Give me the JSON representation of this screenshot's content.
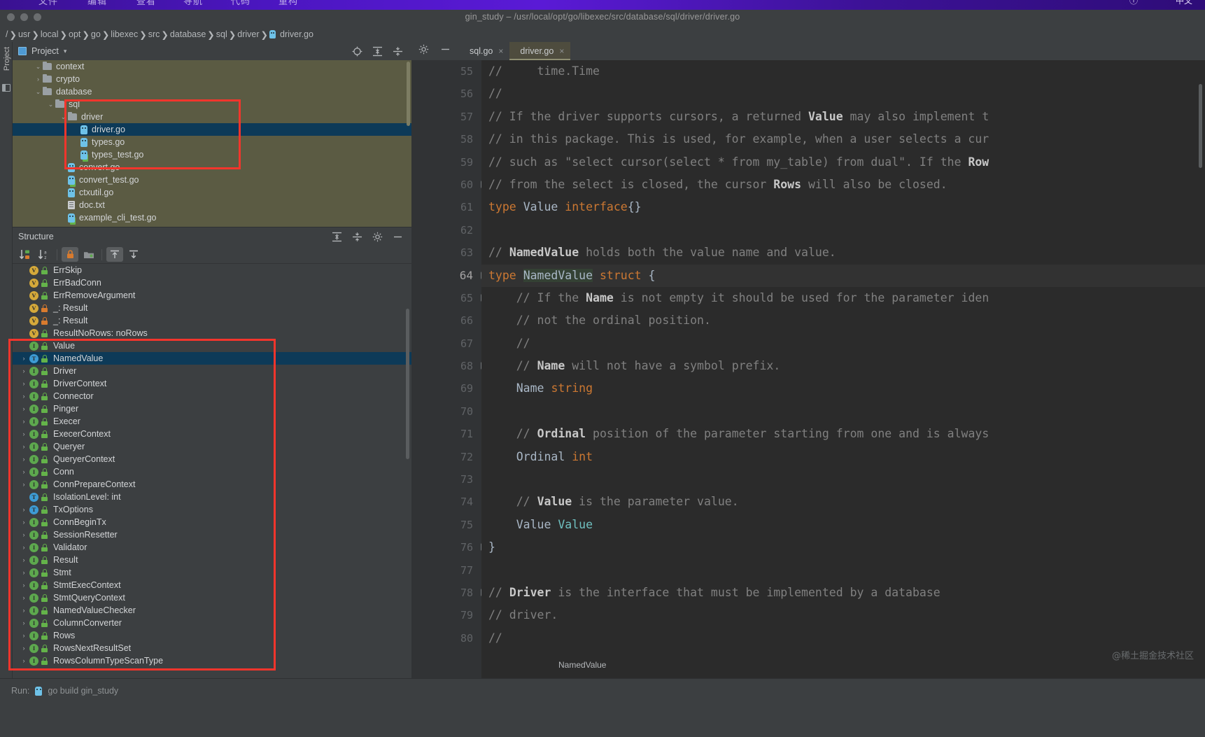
{
  "osbar": {
    "menus": [
      "文件",
      "编辑",
      "查看",
      "导航",
      "代码",
      "重构"
    ],
    "right_items": [
      "ⓘ",
      "中文"
    ]
  },
  "window": {
    "title": "gin_study – /usr/local/opt/go/libexec/src/database/sql/driver/driver.go"
  },
  "breadcrumb": {
    "root": "/",
    "items": [
      "usr",
      "local",
      "opt",
      "go",
      "libexec",
      "src",
      "database",
      "sql",
      "driver"
    ],
    "file": "driver.go"
  },
  "toolstrip": {
    "label": "Project"
  },
  "project_panel": {
    "title": "Project",
    "caret": "▾",
    "tree": [
      {
        "label": "context",
        "indent": 1,
        "arrow": "⌄",
        "icon": "folder",
        "selected": false
      },
      {
        "label": "crypto",
        "indent": 1,
        "arrow": "›",
        "icon": "folder",
        "selected": false
      },
      {
        "label": "database",
        "indent": 1,
        "arrow": "⌄",
        "icon": "folder",
        "selected": false
      },
      {
        "label": "sql",
        "indent": 2,
        "arrow": "⌄",
        "icon": "folder",
        "selected": false
      },
      {
        "label": "driver",
        "indent": 3,
        "arrow": "⌄",
        "icon": "folder",
        "selected": false
      },
      {
        "label": "driver.go",
        "indent": 4,
        "arrow": "",
        "icon": "go",
        "selected": true
      },
      {
        "label": "types.go",
        "indent": 4,
        "arrow": "",
        "icon": "go",
        "selected": false
      },
      {
        "label": "types_test.go",
        "indent": 4,
        "arrow": "",
        "icon": "go-test",
        "selected": false
      },
      {
        "label": "convert.go",
        "indent": 3,
        "arrow": "",
        "icon": "go",
        "selected": false
      },
      {
        "label": "convert_test.go",
        "indent": 3,
        "arrow": "",
        "icon": "go-test",
        "selected": false
      },
      {
        "label": "ctxutil.go",
        "indent": 3,
        "arrow": "",
        "icon": "go",
        "selected": false
      },
      {
        "label": "doc.txt",
        "indent": 3,
        "arrow": "",
        "icon": "txt",
        "selected": false
      },
      {
        "label": "example_cli_test.go",
        "indent": 3,
        "arrow": "",
        "icon": "go-test",
        "selected": false
      }
    ]
  },
  "structure_panel": {
    "title": "Structure",
    "toolbar": [
      {
        "name": "sort-by-visibility",
        "glyph": "↓",
        "active": false
      },
      {
        "name": "sort-alphabetically",
        "glyph": "↓",
        "active": false
      },
      {
        "name": "show-non-public",
        "glyph": "",
        "active": true
      },
      {
        "name": "group-by-folder",
        "glyph": "",
        "active": false
      },
      {
        "name": "expand-all",
        "glyph": "",
        "active": true
      },
      {
        "name": "collapse-all",
        "glyph": "",
        "active": false
      }
    ],
    "items": [
      {
        "label": "ErrSkip",
        "kind": "v",
        "lock": "green",
        "arrow": false,
        "selected": false
      },
      {
        "label": "ErrBadConn",
        "kind": "v",
        "lock": "green",
        "arrow": false,
        "selected": false
      },
      {
        "label": "ErrRemoveArgument",
        "kind": "v",
        "lock": "green",
        "arrow": false,
        "selected": false
      },
      {
        "label": "_: Result",
        "kind": "v",
        "lock": "orange",
        "arrow": false,
        "selected": false
      },
      {
        "label": "_: Result",
        "kind": "v",
        "lock": "orange",
        "arrow": false,
        "selected": false
      },
      {
        "label": "ResultNoRows: noRows",
        "kind": "v",
        "lock": "green",
        "arrow": false,
        "selected": false
      },
      {
        "label": "Value",
        "kind": "i",
        "lock": "green",
        "arrow": false,
        "selected": false
      },
      {
        "label": "NamedValue",
        "kind": "t",
        "lock": "green",
        "arrow": true,
        "selected": true
      },
      {
        "label": "Driver",
        "kind": "i",
        "lock": "green",
        "arrow": true,
        "selected": false
      },
      {
        "label": "DriverContext",
        "kind": "i",
        "lock": "green",
        "arrow": true,
        "selected": false
      },
      {
        "label": "Connector",
        "kind": "i",
        "lock": "green",
        "arrow": true,
        "selected": false
      },
      {
        "label": "Pinger",
        "kind": "i",
        "lock": "green",
        "arrow": true,
        "selected": false
      },
      {
        "label": "Execer",
        "kind": "i",
        "lock": "green",
        "arrow": true,
        "selected": false
      },
      {
        "label": "ExecerContext",
        "kind": "i",
        "lock": "green",
        "arrow": true,
        "selected": false
      },
      {
        "label": "Queryer",
        "kind": "i",
        "lock": "green",
        "arrow": true,
        "selected": false
      },
      {
        "label": "QueryerContext",
        "kind": "i",
        "lock": "green",
        "arrow": true,
        "selected": false
      },
      {
        "label": "Conn",
        "kind": "i",
        "lock": "green",
        "arrow": true,
        "selected": false
      },
      {
        "label": "ConnPrepareContext",
        "kind": "i",
        "lock": "green",
        "arrow": true,
        "selected": false
      },
      {
        "label": "IsolationLevel: int",
        "kind": "t",
        "lock": "green",
        "arrow": false,
        "selected": false
      },
      {
        "label": "TxOptions",
        "kind": "t",
        "lock": "green",
        "arrow": true,
        "selected": false
      },
      {
        "label": "ConnBeginTx",
        "kind": "i",
        "lock": "green",
        "arrow": true,
        "selected": false
      },
      {
        "label": "SessionResetter",
        "kind": "i",
        "lock": "green",
        "arrow": true,
        "selected": false
      },
      {
        "label": "Validator",
        "kind": "i",
        "lock": "green",
        "arrow": true,
        "selected": false
      },
      {
        "label": "Result",
        "kind": "i",
        "lock": "green",
        "arrow": true,
        "selected": false
      },
      {
        "label": "Stmt",
        "kind": "i",
        "lock": "green",
        "arrow": true,
        "selected": false
      },
      {
        "label": "StmtExecContext",
        "kind": "i",
        "lock": "green",
        "arrow": true,
        "selected": false
      },
      {
        "label": "StmtQueryContext",
        "kind": "i",
        "lock": "green",
        "arrow": true,
        "selected": false
      },
      {
        "label": "NamedValueChecker",
        "kind": "i",
        "lock": "green",
        "arrow": true,
        "selected": false
      },
      {
        "label": "ColumnConverter",
        "kind": "i",
        "lock": "green",
        "arrow": true,
        "selected": false
      },
      {
        "label": "Rows",
        "kind": "i",
        "lock": "green",
        "arrow": true,
        "selected": false
      },
      {
        "label": "RowsNextResultSet",
        "kind": "i",
        "lock": "green",
        "arrow": true,
        "selected": false
      },
      {
        "label": "RowsColumnTypeScanType",
        "kind": "i",
        "lock": "green",
        "arrow": true,
        "selected": false
      }
    ]
  },
  "editor": {
    "tabs": [
      {
        "label": "sql.go",
        "active": false,
        "close": "×"
      },
      {
        "label": "driver.go",
        "active": true,
        "close": "×"
      }
    ],
    "first_line": 55,
    "lines": [
      {
        "n": 55,
        "fold": "",
        "html": "<span class='cmt'>//     time.Time</span>"
      },
      {
        "n": 56,
        "fold": "",
        "html": "<span class='cmt'>//</span>"
      },
      {
        "n": 57,
        "fold": "",
        "html": "<span class='cmt'>// If the driver supports cursors, a returned <b>Value</b> may also implement t</span>"
      },
      {
        "n": 58,
        "fold": "",
        "html": "<span class='cmt'>// in this package. This is used, for example, when a user selects a cur</span>"
      },
      {
        "n": 59,
        "fold": "",
        "html": "<span class='cmt'>// such as \"select cursor(select * from my_table) from dual\". If the <b>Row</b></span>"
      },
      {
        "n": 60,
        "fold": "end",
        "html": "<span class='cmt'>// from the select is closed, the cursor <b>Rows</b> will also be closed.</span>"
      },
      {
        "n": 61,
        "fold": "",
        "html": "<span class='kw'>type</span> <span class='id'>Value</span> <span class='kw'>interface</span>{}"
      },
      {
        "n": 62,
        "fold": "",
        "html": ""
      },
      {
        "n": 63,
        "fold": "",
        "html": "<span class='cmt'>// <b>NamedValue</b> holds both the value name and value.</span>"
      },
      {
        "n": 64,
        "fold": "start",
        "html": "<span class='kw'>type</span> <span class='sel-ident'>NamedValue</span> <span class='kw'>struct</span> {",
        "current": true
      },
      {
        "n": 65,
        "fold": "start",
        "html": "    <span class='cmt'>// If the <b>Name</b> is not empty it should be used for the parameter iden</span>"
      },
      {
        "n": 66,
        "fold": "",
        "html": "    <span class='cmt'>// not the ordinal position.</span>"
      },
      {
        "n": 67,
        "fold": "",
        "html": "    <span class='cmt'>//</span>"
      },
      {
        "n": 68,
        "fold": "end",
        "html": "    <span class='cmt'>// <b>Name</b> will not have a symbol prefix.</span>"
      },
      {
        "n": 69,
        "fold": "",
        "html": "    <span class='id'>Name</span> <span class='kw'>string</span>"
      },
      {
        "n": 70,
        "fold": "",
        "html": ""
      },
      {
        "n": 71,
        "fold": "",
        "html": "    <span class='cmt'>// <b>Ordinal</b> position of the parameter starting from one and is always</span>"
      },
      {
        "n": 72,
        "fold": "",
        "html": "    <span class='id'>Ordinal</span> <span class='kw'>int</span>"
      },
      {
        "n": 73,
        "fold": "",
        "html": ""
      },
      {
        "n": 74,
        "fold": "",
        "html": "    <span class='cmt'>// <b>Value</b> is the parameter value.</span>"
      },
      {
        "n": 75,
        "fold": "",
        "html": "    <span class='id'>Value</span> <span class='tref'>Value</span>"
      },
      {
        "n": 76,
        "fold": "end",
        "html": "}"
      },
      {
        "n": 77,
        "fold": "",
        "html": ""
      },
      {
        "n": 78,
        "fold": "start",
        "html": "<span class='cmt'>// <b>Driver</b> is the interface that must be implemented by a database</span>"
      },
      {
        "n": 79,
        "fold": "",
        "html": "<span class='cmt'>// driver.</span>"
      },
      {
        "n": 80,
        "fold": "",
        "html": "<span class='cmt'>//</span>"
      }
    ]
  },
  "status": {
    "breadcrumb": "NamedValue",
    "run_label": "Run:",
    "run_config": "go build gin_study"
  },
  "watermark": "@稀土掘金技术社区",
  "colors": {
    "selection": "#0d3a58",
    "project_tree_bg": "#5b5b43",
    "editor_bg": "#2b2b2b",
    "panel_bg": "#3c3f41",
    "keyword": "#cc7832",
    "comment": "#808080",
    "type_ref": "#6fc0c0",
    "annotation": "#f3352c"
  }
}
